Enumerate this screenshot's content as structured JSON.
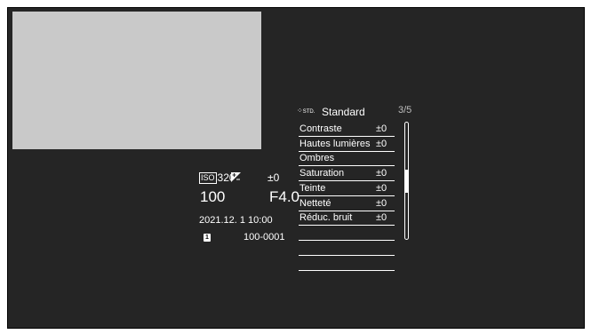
{
  "playback": {
    "iso_badge": "ISO",
    "iso_value": "3200",
    "exposure_comp": "±0",
    "shutter": "100",
    "aperture": "F4.0",
    "datetime": "2021.12. 1 10:00",
    "card_slot": "1",
    "file_number": "100-0001"
  },
  "menu": {
    "icon_label": "STD.",
    "title": "Standard",
    "page": "3/5",
    "items": [
      {
        "label": "Contraste",
        "value": "±0"
      },
      {
        "label": "Hautes lumières",
        "value": "±0"
      },
      {
        "label": "Ombres",
        "value": ""
      },
      {
        "label": "Saturation",
        "value": "±0"
      },
      {
        "label": "Teinte",
        "value": "±0"
      },
      {
        "label": "Netteté",
        "value": "±0"
      },
      {
        "label": "Réduc. bruit",
        "value": "±0"
      },
      {
        "label": "",
        "value": ""
      },
      {
        "label": "",
        "value": ""
      },
      {
        "label": "",
        "value": ""
      }
    ]
  },
  "colors": {
    "background": "#252525",
    "text": "#ffffff",
    "thumbnail": "#c9c9c9"
  }
}
